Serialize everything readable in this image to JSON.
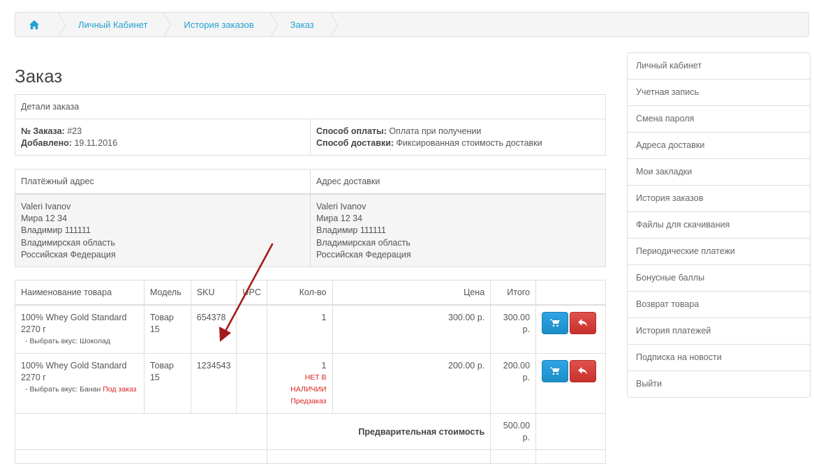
{
  "breadcrumb": {
    "items": [
      "Личный Кабинет",
      "История заказов",
      "Заказ"
    ]
  },
  "title": "Заказ",
  "details": {
    "header": "Детали заказа",
    "order_no_label": "№ Заказа:",
    "order_no": "#23",
    "added_label": "Добавлено:",
    "added": "19.11.2016",
    "payment_label": "Способ оплаты:",
    "payment": "Оплата при получении",
    "shipping_label": "Способ доставки:",
    "shipping": "Фиксированная стоимость доставки"
  },
  "addresses": {
    "payment_header": "Платёжный адрес",
    "shipping_header": "Адрес доставки",
    "payment_lines": [
      "Valeri Ivanov",
      "Мира 12 34",
      "Владимир 111111",
      "Владимирская область",
      "Российская Федерация"
    ],
    "shipping_lines": [
      "Valeri Ivanov",
      "Мира 12 34",
      "Владимир 111111",
      "Владимирская область",
      "Российская Федерация"
    ]
  },
  "products": {
    "columns": [
      "Наименование товара",
      "Модель",
      "SKU",
      "UPC",
      "Кол-во",
      "Цена",
      "Итого"
    ],
    "rows": [
      {
        "name": "100% Whey Gold Standard 2270 г",
        "option": "- Выбрать вкус: Шоколад",
        "option_extra": "",
        "model": "Товар 15",
        "sku": "654378",
        "upc": "",
        "qty": "1",
        "stock": [
          "",
          ""
        ],
        "price": "300.00 р.",
        "total": "300.00 р."
      },
      {
        "name": "100% Whey Gold Standard 2270 г",
        "option": "- Выбрать вкус: Банан",
        "option_extra": "Под заказ",
        "model": "Товар 15",
        "sku": "1234543",
        "upc": "",
        "qty": "1",
        "stock": [
          "НЕТ В НАЛИЧИИ",
          "Предзаказ"
        ],
        "price": "200.00 р.",
        "total": "200.00 р."
      }
    ],
    "subtotal_label": "Предварительная стоимость",
    "subtotal": "500.00 р."
  },
  "sidebar": {
    "items": [
      "Личный кабинет",
      "Учетная запись",
      "Смена пароля",
      "Адреса доставки",
      "Мои закладки",
      "История заказов",
      "Файлы для скачивания",
      "Периодические платежи",
      "Бонусные баллы",
      "Возврат товара",
      "История платежей",
      "Подписка на новости",
      "Выйти"
    ]
  },
  "colors": {
    "link": "#23a1d1",
    "cart_button": "#1b8ec6",
    "return_button": "#c9302c",
    "stock_warning": "#d9231d",
    "arrow": "#a5191c"
  }
}
